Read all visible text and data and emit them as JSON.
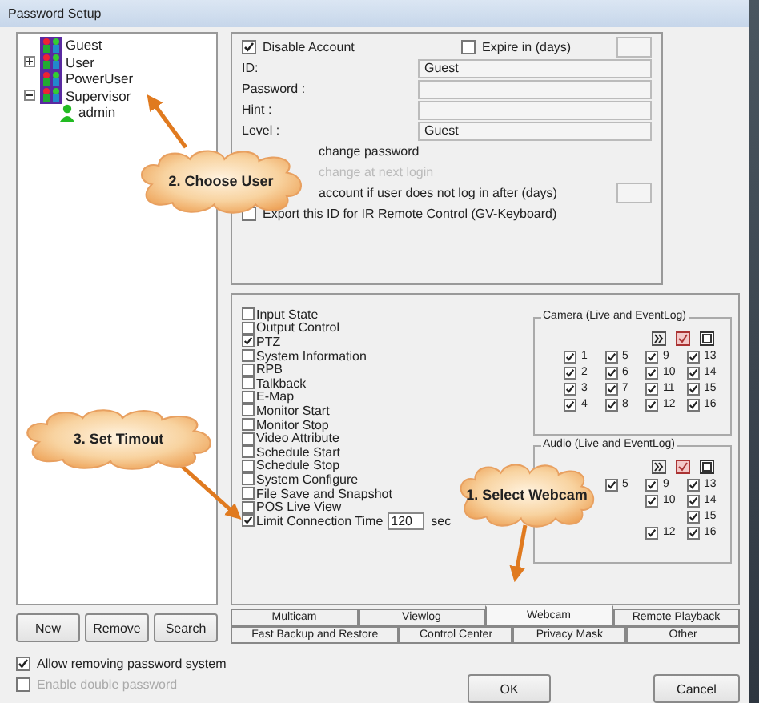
{
  "window": {
    "title": "Password Setup"
  },
  "tree": [
    {
      "label": "Guest",
      "kind": "group"
    },
    {
      "label": "User",
      "kind": "group",
      "expanded": false
    },
    {
      "label": "PowerUser",
      "kind": "group"
    },
    {
      "label": "Supervisor",
      "kind": "group",
      "expanded": true,
      "children": [
        {
          "label": "admin",
          "kind": "user"
        }
      ]
    }
  ],
  "left_buttons": [
    "New",
    "Remove",
    "Search"
  ],
  "left_options": [
    {
      "label": "Allow removing password system",
      "checked": true,
      "disabled": false
    },
    {
      "label": "Enable double password",
      "checked": false,
      "disabled": true
    }
  ],
  "account": {
    "disable": {
      "label": "Disable Account",
      "checked": true
    },
    "expire": {
      "label": "Expire in (days)",
      "checked": false
    },
    "fields": [
      {
        "label": "ID:",
        "value": "Guest"
      },
      {
        "label": "Password :"
      },
      {
        "label": "Hint :"
      },
      {
        "label": "Level :",
        "value": "Guest"
      }
    ],
    "options": [
      {
        "label": "change password",
        "disabled": false,
        "has_box": false
      },
      {
        "label": "change at next login",
        "disabled": true,
        "has_box": false
      },
      {
        "label": "account if user does not log in after (days)",
        "disabled": false,
        "has_box": true
      }
    ],
    "export": {
      "label": "Export this ID for IR Remote Control (GV-Keyboard)",
      "checked": false
    }
  },
  "permissions": [
    {
      "kind": "check",
      "label": "Input State",
      "checked": false
    },
    {
      "kind": "check",
      "label": "Output Control",
      "checked": false
    },
    {
      "kind": "check",
      "label": "PTZ",
      "checked": true
    },
    {
      "kind": "check",
      "label": "System Information",
      "checked": false
    },
    {
      "kind": "check",
      "label": "RPB",
      "checked": false
    },
    {
      "kind": "check",
      "label": "Talkback",
      "checked": false
    },
    {
      "kind": "check",
      "label": "E-Map",
      "checked": false
    },
    {
      "kind": "check",
      "label": "Monitor Start",
      "checked": false
    },
    {
      "kind": "check",
      "label": "Monitor Stop",
      "checked": false
    },
    {
      "kind": "check",
      "label": "Video Attribute",
      "checked": false
    },
    {
      "kind": "check",
      "label": "Schedule Start",
      "checked": false
    },
    {
      "kind": "check",
      "label": "Schedule Stop",
      "checked": false
    },
    {
      "kind": "check",
      "label": "System Configure",
      "checked": false
    },
    {
      "kind": "check",
      "label": "File Save and Snapshot",
      "checked": false
    },
    {
      "kind": "check",
      "label": "POS Live View",
      "checked": false
    },
    {
      "kind": "timeout",
      "label": "Limit Connection Time",
      "checked": true,
      "value": "120",
      "unit": "sec"
    }
  ],
  "camera": {
    "title": "Camera (Live and EventLog)",
    "rows": [
      [
        {
          "n": "1",
          "checked": true
        },
        {
          "n": "5",
          "checked": true
        },
        {
          "n": "9",
          "checked": true
        },
        {
          "n": "13",
          "checked": true
        }
      ],
      [
        {
          "n": "2",
          "checked": true
        },
        {
          "n": "6",
          "checked": true
        },
        {
          "n": "10",
          "checked": true
        },
        {
          "n": "14",
          "checked": true
        }
      ],
      [
        {
          "n": "3",
          "checked": true
        },
        {
          "n": "7",
          "checked": true
        },
        {
          "n": "11",
          "checked": true
        },
        {
          "n": "15",
          "checked": true
        }
      ],
      [
        {
          "n": "4",
          "checked": true
        },
        {
          "n": "8",
          "checked": true
        },
        {
          "n": "12",
          "checked": true
        },
        {
          "n": "16",
          "checked": true
        }
      ]
    ]
  },
  "audio": {
    "title": "Audio (Live and EventLog)",
    "rows": [
      [
        null,
        {
          "n": "5",
          "checked": true
        },
        {
          "n": "9",
          "checked": true
        },
        {
          "n": "13",
          "checked": true
        }
      ],
      [
        null,
        null,
        {
          "n": "10",
          "checked": true
        },
        {
          "n": "14",
          "checked": true
        }
      ],
      [
        null,
        null,
        null,
        {
          "n": "15",
          "checked": true
        }
      ],
      [
        null,
        null,
        {
          "n": "12",
          "checked": true
        },
        {
          "n": "16",
          "checked": true
        }
      ]
    ]
  },
  "tabs": [
    [
      {
        "label": "Multicam",
        "selected": false
      },
      {
        "label": "Viewlog",
        "selected": false
      },
      {
        "label": "Webcam",
        "selected": true
      },
      {
        "label": "Remote Playback",
        "selected": false
      }
    ],
    [
      {
        "label": "Fast Backup and Restore",
        "selected": false
      },
      {
        "label": "Control Center",
        "selected": false
      },
      {
        "label": "Privacy Mask",
        "selected": false
      },
      {
        "label": "Other",
        "selected": false
      }
    ]
  ],
  "dialog_buttons": [
    "OK",
    "Cancel"
  ],
  "callouts": [
    {
      "text": "2. Choose User"
    },
    {
      "text": "3. Set Timout"
    },
    {
      "text": "1. Select Webcam"
    }
  ]
}
